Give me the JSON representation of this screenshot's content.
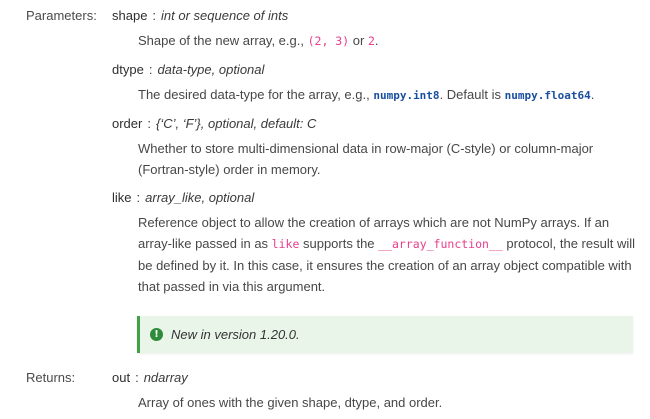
{
  "sections": {
    "parameters_label": "Parameters:",
    "returns_label": "Returns:"
  },
  "params": {
    "shape": {
      "name": "shape",
      "type": "int or sequence of ints",
      "desc_1": "Shape of the new array, e.g., ",
      "code_1": "(2, 3)",
      "desc_2": " or ",
      "code_2": "2",
      "desc_3": "."
    },
    "dtype": {
      "name": "dtype",
      "type": "data-type, optional",
      "desc_1": "The desired data-type for the array, e.g., ",
      "code_1": "numpy.int8",
      "desc_2": ". Default is ",
      "code_2": "numpy.float64",
      "desc_3": "."
    },
    "order": {
      "name": "order",
      "type": "{‘C’, ‘F’}, optional, default: C",
      "desc": "Whether to store multi-dimensional data in row-major (C-style) or column-major (Fortran-style) order in memory."
    },
    "like": {
      "name": "like",
      "type": "array_like, optional",
      "desc_1": "Reference object to allow the creation of arrays which are not NumPy arrays. If an array-like passed in as ",
      "code_1": "like",
      "desc_2": " supports the ",
      "code_2": "__array_function__",
      "desc_3": " protocol, the result will be defined by it. In this case, it ensures the creation of an array object compatible with that passed in via this argument."
    }
  },
  "note": {
    "text": "New in version 1.20.0.",
    "icon": "exclamation-icon"
  },
  "returns": {
    "name": "out",
    "type": "ndarray",
    "desc": "Array of ones with the given shape, dtype, and order."
  }
}
